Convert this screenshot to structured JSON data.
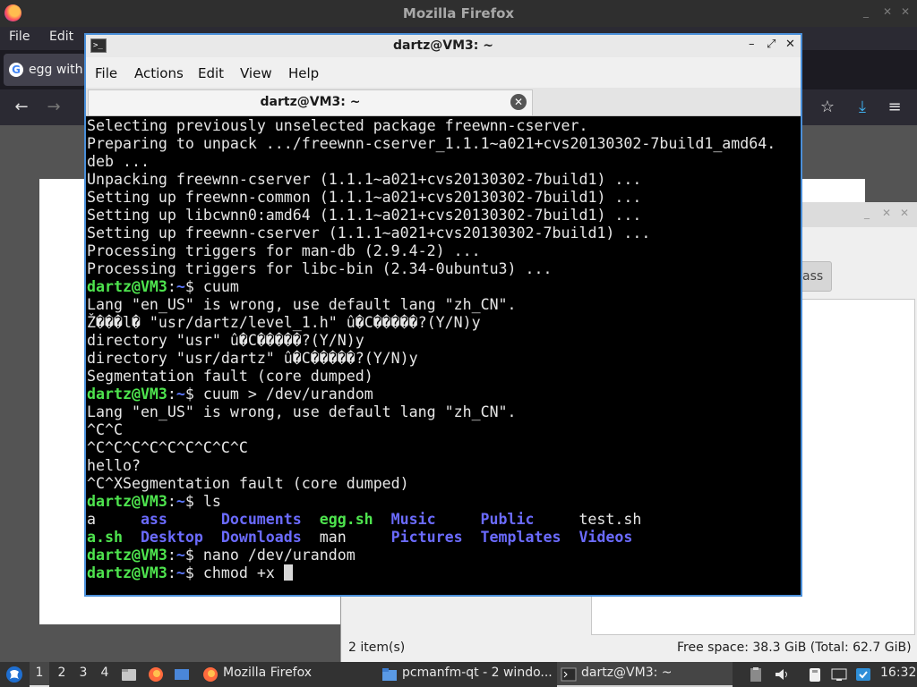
{
  "firefox": {
    "title": "Mozilla Firefox",
    "menu": [
      "File",
      "Edit"
    ],
    "tab_label": "egg with",
    "tab_favicon": "G"
  },
  "file_manager": {
    "button_label": "ass",
    "status_items": "2 item(s)",
    "status_space": "Free space: 38.3 GiB (Total: 62.7 GiB)"
  },
  "terminal": {
    "title": "dartz@VM3: ~",
    "menu": [
      "File",
      "Actions",
      "Edit",
      "View",
      "Help"
    ],
    "tab_label": "dartz@VM3: ~",
    "prompt_user": "dartz@VM3",
    "prompt_sep": ":",
    "prompt_path": "~",
    "prompt_dollar": "$",
    "lines": [
      {
        "type": "text",
        "text": "Selecting previously unselected package freewnn-cserver."
      },
      {
        "type": "text",
        "text": "Preparing to unpack .../freewnn-cserver_1.1.1~a021+cvs20130302-7build1_amd64."
      },
      {
        "type": "text",
        "text": "deb ..."
      },
      {
        "type": "text",
        "text": "Unpacking freewnn-cserver (1.1.1~a021+cvs20130302-7build1) ..."
      },
      {
        "type": "text",
        "text": "Setting up freewnn-common (1.1.1~a021+cvs20130302-7build1) ..."
      },
      {
        "type": "text",
        "text": "Setting up libcwnn0:amd64 (1.1.1~a021+cvs20130302-7build1) ..."
      },
      {
        "type": "text",
        "text": "Setting up freewnn-cserver (1.1.1~a021+cvs20130302-7build1) ..."
      },
      {
        "type": "text",
        "text": "Processing triggers for man-db (2.9.4-2) ..."
      },
      {
        "type": "text",
        "text": "Processing triggers for libc-bin (2.34-0ubuntu3) ..."
      },
      {
        "type": "prompt",
        "cmd": " cuum"
      },
      {
        "type": "text",
        "text": "Lang \"en_US\" is wrong, use default lang \"zh_CN\"."
      },
      {
        "type": "text",
        "text": "Ž���l� \"usr/dartz/level_1.h\" û�C�����?(Y/N)y"
      },
      {
        "type": "text",
        "text": "directory \"usr\" û�C�����?(Y/N)y"
      },
      {
        "type": "text",
        "text": "directory \"usr/dartz\" û�C�����?(Y/N)y"
      },
      {
        "type": "text",
        "text": "Segmentation fault (core dumped)"
      },
      {
        "type": "prompt",
        "cmd": " cuum > /dev/urandom"
      },
      {
        "type": "text",
        "text": "Lang \"en_US\" is wrong, use default lang \"zh_CN\"."
      },
      {
        "type": "text",
        "text": "^C^C"
      },
      {
        "type": "text",
        "text": "^C^C^C^C^C^C^C^C^C"
      },
      {
        "type": "text",
        "text": "hello?"
      },
      {
        "type": "text",
        "text": "^C^XSegmentation fault (core dumped)"
      },
      {
        "type": "prompt",
        "cmd": " ls"
      },
      {
        "type": "ls",
        "items": [
          {
            "name": "a",
            "kind": "file"
          },
          {
            "name": "ass",
            "kind": "dir"
          },
          {
            "name": "Documents",
            "kind": "dir"
          },
          {
            "name": "egg.sh",
            "kind": "exe"
          },
          {
            "name": "Music",
            "kind": "dir"
          },
          {
            "name": "Public",
            "kind": "dir"
          },
          {
            "name": "test.sh",
            "kind": "file"
          }
        ]
      },
      {
        "type": "ls",
        "items": [
          {
            "name": "a.sh",
            "kind": "exe"
          },
          {
            "name": "Desktop",
            "kind": "dir"
          },
          {
            "name": "Downloads",
            "kind": "dir"
          },
          {
            "name": "man",
            "kind": "file"
          },
          {
            "name": "Pictures",
            "kind": "dir"
          },
          {
            "name": "Templates",
            "kind": "dir"
          },
          {
            "name": "Videos",
            "kind": "dir"
          }
        ]
      },
      {
        "type": "prompt",
        "cmd": " nano /dev/urandom"
      },
      {
        "type": "prompt",
        "cmd": " chmod +x ",
        "cursor": true
      }
    ]
  },
  "taskbar": {
    "workspaces": [
      "1",
      "2",
      "3",
      "4"
    ],
    "active_workspace": "1",
    "tasks": [
      {
        "label": "Mozilla Firefox",
        "icon": "firefox-icon"
      },
      {
        "label": "pcmanfm-qt - 2 windo...",
        "icon": "folder-icon"
      },
      {
        "label": "dartz@VM3: ~",
        "icon": "terminal-icon"
      }
    ],
    "clock": "16:32"
  },
  "colors": {
    "prompt_user": "#4ee44e",
    "prompt_path": "#5c78ff",
    "dir": "#6b6bff",
    "exe": "#4ee44e",
    "active_border": "#4a8fd9"
  }
}
